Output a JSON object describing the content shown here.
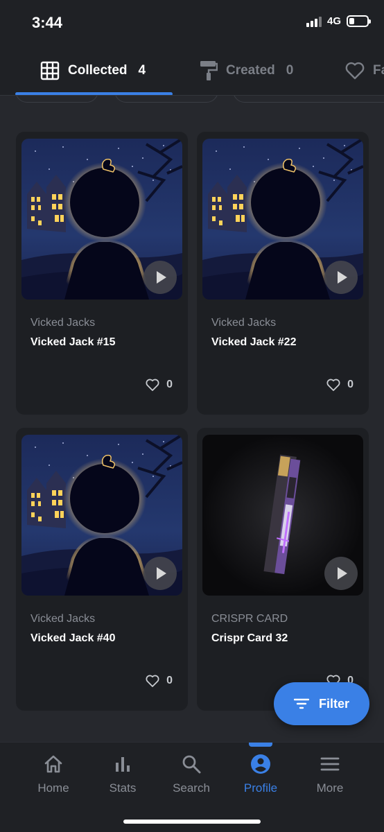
{
  "status_bar": {
    "time": "3:44",
    "network": "4G"
  },
  "tabs": [
    {
      "label": "Collected",
      "count": "4",
      "icon": "grid-icon"
    },
    {
      "label": "Created",
      "count": "0",
      "icon": "paint-roller-icon"
    },
    {
      "label": "Fa",
      "count": "",
      "icon": "heart-icon"
    }
  ],
  "cards": [
    {
      "collection": "Vicked Jacks",
      "title": "Vicked Jack #15",
      "likes": "0",
      "image": "pumpkin-silhouette"
    },
    {
      "collection": "Vicked Jacks",
      "title": "Vicked Jack #22",
      "likes": "0",
      "image": "pumpkin-silhouette"
    },
    {
      "collection": "Vicked Jacks",
      "title": "Vicked Jack #40",
      "likes": "0",
      "image": "pumpkin-silhouette"
    },
    {
      "collection": "CRISPR CARD",
      "title": "Crispr Card 32",
      "likes": "0",
      "image": "crispr-card"
    }
  ],
  "filter_button": {
    "label": "Filter"
  },
  "bottom_nav": [
    {
      "label": "Home",
      "icon": "home-icon"
    },
    {
      "label": "Stats",
      "icon": "bar-chart-icon"
    },
    {
      "label": "Search",
      "icon": "search-icon"
    },
    {
      "label": "Profile",
      "icon": "profile-icon",
      "active": true
    },
    {
      "label": "More",
      "icon": "menu-icon"
    }
  ],
  "colors": {
    "accent": "#3a80e6",
    "background": "#26282d",
    "card": "#1d1f23"
  }
}
